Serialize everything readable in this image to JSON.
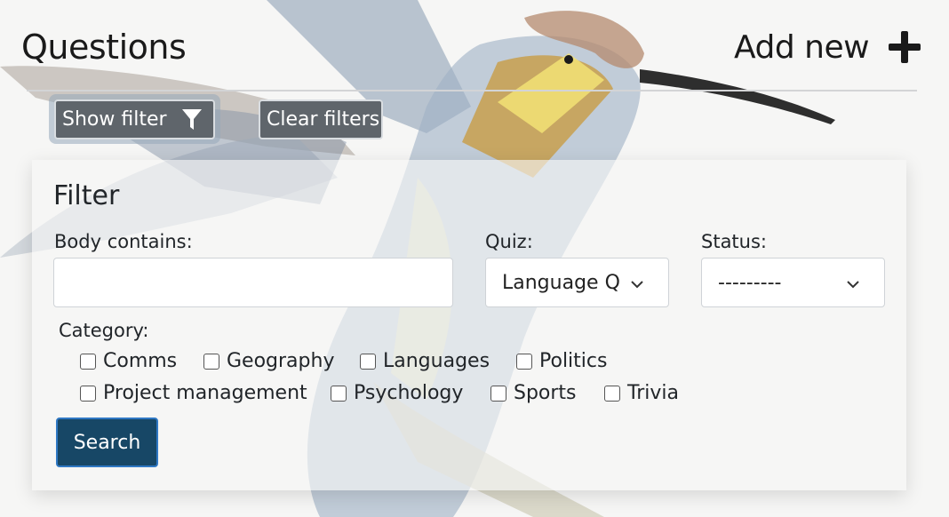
{
  "header": {
    "title": "Questions",
    "add_new_label": "Add new"
  },
  "toolbar": {
    "show_filter_label": "Show filter",
    "clear_filters_label": "Clear filters"
  },
  "filter": {
    "title": "Filter",
    "body_label": "Body contains:",
    "body_value": "",
    "quiz_label": "Quiz:",
    "quiz_value": "Language Q",
    "status_label": "Status:",
    "status_value": "---------",
    "category_label": "Category:",
    "categories": [
      {
        "label": "Comms",
        "checked": false
      },
      {
        "label": "Geography",
        "checked": false
      },
      {
        "label": "Languages",
        "checked": false
      },
      {
        "label": "Politics",
        "checked": false
      },
      {
        "label": "Project management",
        "checked": false
      },
      {
        "label": "Psychology",
        "checked": false
      },
      {
        "label": "Sports",
        "checked": false
      },
      {
        "label": "Trivia",
        "checked": false
      }
    ],
    "search_label": "Search"
  },
  "icons": {
    "add": "plus-icon",
    "filter": "funnel-icon",
    "select": "chevron-down-icon",
    "background": "hummingbird-illustration"
  },
  "colors": {
    "page_bg": "#f6f6f5",
    "secondary_button": "#5f656b",
    "primary_button": "#174766",
    "primary_border": "#2f78c4"
  }
}
